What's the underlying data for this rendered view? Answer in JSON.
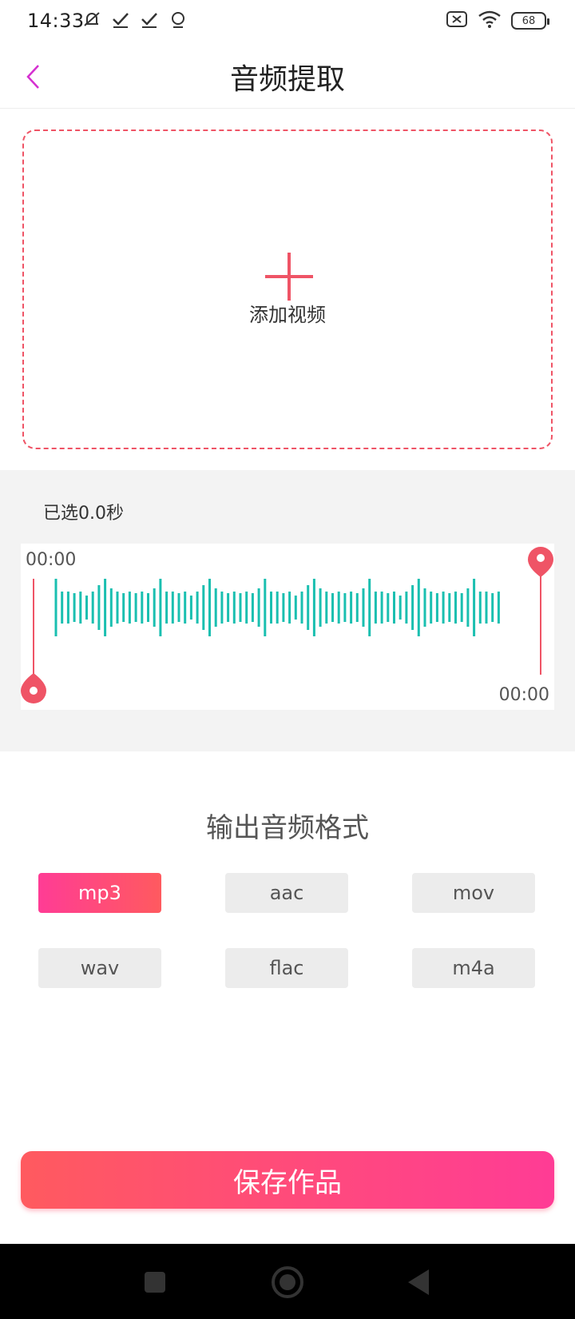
{
  "status_bar": {
    "time": "14:33",
    "left_icons": [
      "mute-icon",
      "check-icon",
      "check-icon",
      "location-icon"
    ],
    "right_icons": [
      "sim-off-icon",
      "wifi-icon",
      "battery-icon"
    ],
    "battery_level": "68"
  },
  "header": {
    "back_icon": "chevron-left-icon",
    "title": "音频提取"
  },
  "upload": {
    "icon": "plus-icon",
    "label": "添加视频"
  },
  "trim": {
    "selected_text": "已选0.0秒",
    "start_time": "00:00",
    "end_time": "00:00"
  },
  "format": {
    "title": "输出音频格式",
    "options": [
      "mp3",
      "aac",
      "mov",
      "wav",
      "flac",
      "m4a"
    ],
    "selected": "mp3"
  },
  "save_label": "保存作品",
  "nav": {
    "icons": [
      "square-icon",
      "home-circle-icon",
      "back-triangle-icon"
    ]
  },
  "colors": {
    "accent_pink": "#ff3c95",
    "accent_red": "#ff5a5f",
    "dashed_border": "#ef5466",
    "wave": "#1abfb0"
  }
}
